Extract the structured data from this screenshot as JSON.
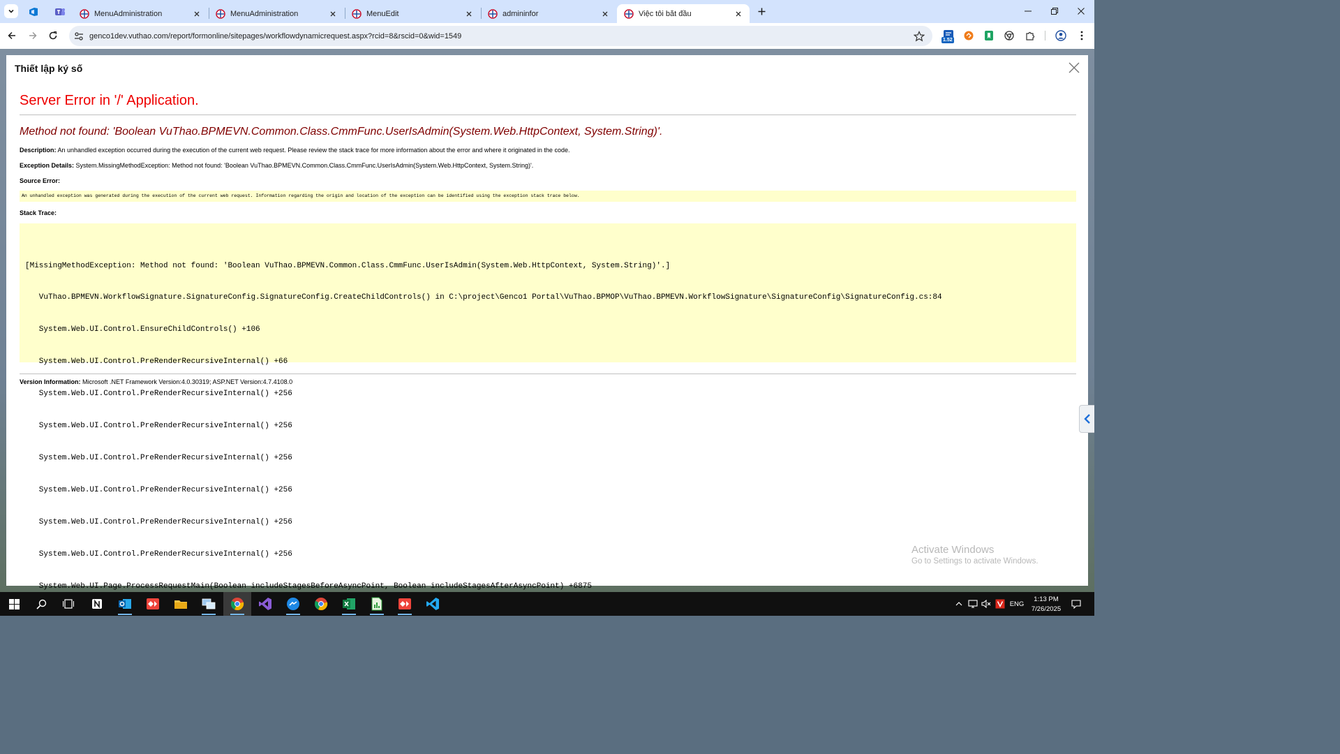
{
  "browser": {
    "tabs": [
      {
        "title": "MenuAdministration",
        "active": false
      },
      {
        "title": "MenuAdministration",
        "active": false
      },
      {
        "title": "MenuEdit",
        "active": false
      },
      {
        "title": "admininfor",
        "active": false
      },
      {
        "title": "Việc tôi bắt đầu",
        "active": true
      }
    ],
    "url": "genco1dev.vuthao.com/report/formonline/sitepages/workflowdynamicrequest.aspx?rcid=8&rscid=0&wid=1549",
    "extension_badge": "1.52"
  },
  "dialog": {
    "title": "Thiết lập ký số"
  },
  "error": {
    "heading": "Server Error in '/' Application.",
    "message": "Method not found: 'Boolean VuThao.BPMEVN.Common.Class.CmmFunc.UserIsAdmin(System.Web.HttpContext, System.String)'.",
    "description_label": "Description:",
    "description_text": "An unhandled exception occurred during the execution of the current web request. Please review the stack trace for more information about the error and where it originated in the code.",
    "exception_label": "Exception Details:",
    "exception_text": "System.MissingMethodException: Method not found: 'Boolean VuThao.BPMEVN.Common.Class.CmmFunc.UserIsAdmin(System.Web.HttpContext, System.String)'.",
    "source_label": "Source Error:",
    "source_text": "An unhandled exception was generated during the execution of the current web request. Information regarding the origin and location of the exception can be identified using the exception stack trace below.",
    "stack_label": "Stack Trace:",
    "stack_lines": [
      "[MissingMethodException: Method not found: 'Boolean VuThao.BPMEVN.Common.Class.CmmFunc.UserIsAdmin(System.Web.HttpContext, System.String)'.]",
      "   VuThao.BPMEVN.WorkflowSignature.SignatureConfig.SignatureConfig.CreateChildControls() in C:\\project\\Genco1 Portal\\VuThao.BPMOP\\VuThao.BPMEVN.WorkflowSignature\\SignatureConfig\\SignatureConfig.cs:84",
      "   System.Web.UI.Control.EnsureChildControls() +106",
      "   System.Web.UI.Control.PreRenderRecursiveInternal() +66",
      "   System.Web.UI.Control.PreRenderRecursiveInternal() +256",
      "   System.Web.UI.Control.PreRenderRecursiveInternal() +256",
      "   System.Web.UI.Control.PreRenderRecursiveInternal() +256",
      "   System.Web.UI.Control.PreRenderRecursiveInternal() +256",
      "   System.Web.UI.Control.PreRenderRecursiveInternal() +256",
      "   System.Web.UI.Control.PreRenderRecursiveInternal() +256",
      "   System.Web.UI.Page.ProcessRequestMain(Boolean includeStagesBeforeAsyncPoint, Boolean includeStagesAfterAsyncPoint) +6875"
    ],
    "version_label": "Version Information:",
    "version_text": "Microsoft .NET Framework Version:4.0.30319; ASP.NET Version:4.7.4108.0"
  },
  "watermark": {
    "line1": "Activate Windows",
    "line2": "Go to Settings to activate Windows."
  },
  "taskbar": {
    "language": "ENG",
    "time": "1:13 PM",
    "date": "7/26/2025"
  },
  "colors": {
    "tabstrip": "#d3e3fd",
    "error_heading": "#ee0000",
    "error_message": "#800000",
    "code_background": "#ffffcc",
    "taskbar": "#101010"
  }
}
